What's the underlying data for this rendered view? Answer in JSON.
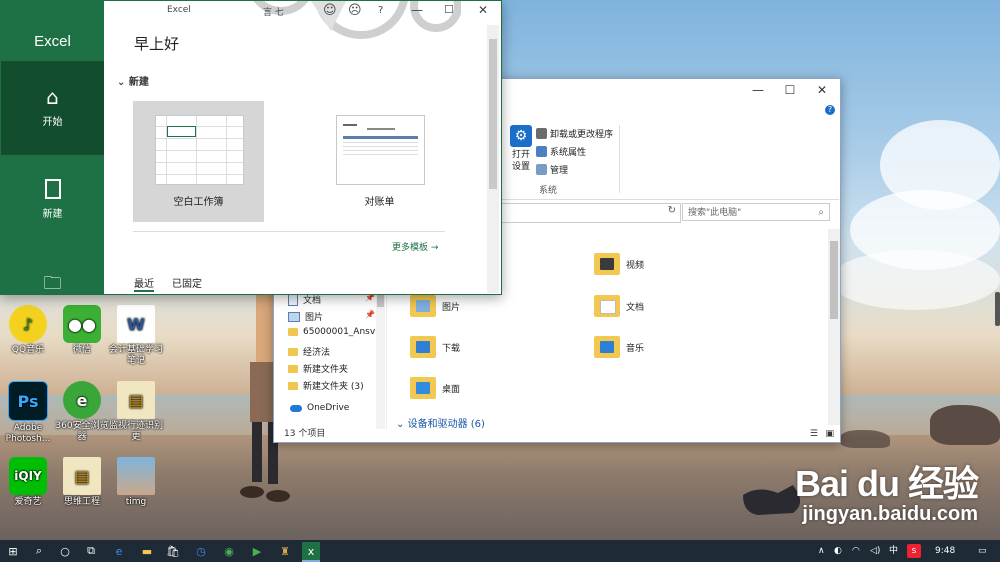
{
  "excel": {
    "app_name": "Excel",
    "window_title": "Excel",
    "user_initials": "言 七",
    "help": "?",
    "greeting": "早上好",
    "nav": [
      {
        "label": "开始"
      },
      {
        "label": "新建"
      },
      {
        "label": ""
      }
    ],
    "section_new": "新建",
    "templates": [
      {
        "label": "空白工作簿"
      },
      {
        "label": "对账单"
      }
    ],
    "more_templates": "更多模板",
    "tabs": [
      {
        "label": "最近"
      },
      {
        "label": "已固定"
      }
    ]
  },
  "explorer": {
    "ribbon": {
      "open_settings_1": "打开",
      "open_settings_2": "设置",
      "uninstall": "卸载或更改程序",
      "system_props": "系统属性",
      "manage": "管理",
      "group": "系统"
    },
    "search_placeholder": "搜索\"此电脑\"",
    "nav_items": [
      {
        "label": "文档"
      },
      {
        "label": "图片"
      },
      {
        "label": "65000001_Ansv"
      },
      {
        "label": "经济法"
      },
      {
        "label": "新建文件夹"
      },
      {
        "label": "新建文件夹 (3)"
      },
      {
        "label": "OneDrive"
      }
    ],
    "folders": [
      {
        "label": "视频"
      },
      {
        "label": "图片"
      },
      {
        "label": "文档"
      },
      {
        "label": "下载"
      },
      {
        "label": "音乐"
      },
      {
        "label": "桌面"
      }
    ],
    "devices_header": "设备和驱动器 (6)",
    "status": "13 个项目"
  },
  "desktop": {
    "icons": [
      {
        "label": "QQ音乐"
      },
      {
        "label": "微信"
      },
      {
        "label": "会计基础学习笔记"
      },
      {
        "label": "Adobe Photosh..."
      },
      {
        "label": "360安全浏览器"
      },
      {
        "label": "监视行迹识别更"
      },
      {
        "label": "爱奇艺"
      },
      {
        "label": "思维工程"
      },
      {
        "label": "timg"
      }
    ],
    "watermark_logo": "Bai du 经验",
    "watermark_url": "jingyan.baidu.com"
  },
  "taskbar": {
    "ime": "中",
    "time": "9:48"
  },
  "colors": {
    "excel_green": "#1e7145",
    "taskbar": "#1e2a36",
    "explorer_accent": "#1c6fc9"
  }
}
